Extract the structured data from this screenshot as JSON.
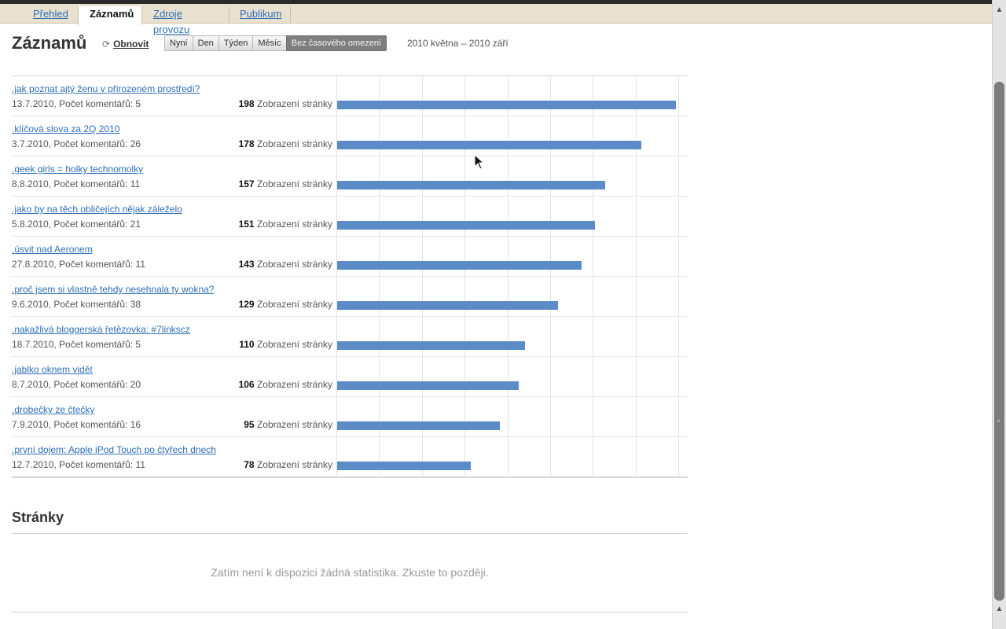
{
  "tabs": [
    "Přehled",
    "Záznamů",
    "Zdroje provozu",
    "Publikum"
  ],
  "active_tab": "Záznamů",
  "header": {
    "title": "Záznamů",
    "refresh_label": "Obnovit",
    "refresh_icon": "refresh-icon",
    "periods": [
      "Nyní",
      "Den",
      "Týden",
      "Měsíc",
      "Bez časového omezení"
    ],
    "active_period": "Bez časového omezení",
    "range": "2010 května – 2010 září"
  },
  "views_label": "Zobrazení stránky",
  "posts": [
    {
      "title": ".jak poznat ajtý ženu v přirozeném prostředí?",
      "meta": "13.7.2010, Počet komentářů: 5",
      "views": 198
    },
    {
      "title": ".klíčová slova za 2Q 2010",
      "meta": "3.7.2010, Počet komentářů: 26",
      "views": 178
    },
    {
      "title": ".geek girls = holky technomolky",
      "meta": "8.8.2010, Počet komentářů: 11",
      "views": 157
    },
    {
      "title": ".jako by na těch obličejích nějak záleželo",
      "meta": "5.8.2010, Počet komentářů: 21",
      "views": 151
    },
    {
      "title": ".úsvit nad Aeronem",
      "meta": "27.8.2010, Počet komentářů: 11",
      "views": 143
    },
    {
      "title": ".proč jsem si vlastně tehdy nesehnala ty wokna?",
      "meta": "9.6.2010, Počet komentářů: 38",
      "views": 129
    },
    {
      "title": ".nakažlivá bloggerská řetězovka: #7linkscz",
      "meta": "18.7.2010, Počet komentářů: 5",
      "views": 110
    },
    {
      "title": ".jablko oknem vidět",
      "meta": "8.7.2010, Počet komentářů: 20",
      "views": 106
    },
    {
      "title": ".drobečky ze čtečky",
      "meta": "7.9.2010, Počet komentářů: 16",
      "views": 95
    },
    {
      "title": ".první dojem: Apple iPod Touch po čtyřech dnech",
      "meta": "12.7.2010, Počet komentářů: 11",
      "views": 78
    }
  ],
  "pages": {
    "title": "Stránky",
    "empty_message": "Zatím není k dispozici žádná statistika. Zkuste to později."
  },
  "colors": {
    "bar": "#5b8cc8",
    "link": "#2f6fb7",
    "tab_strip": "#e9e1cf"
  }
}
